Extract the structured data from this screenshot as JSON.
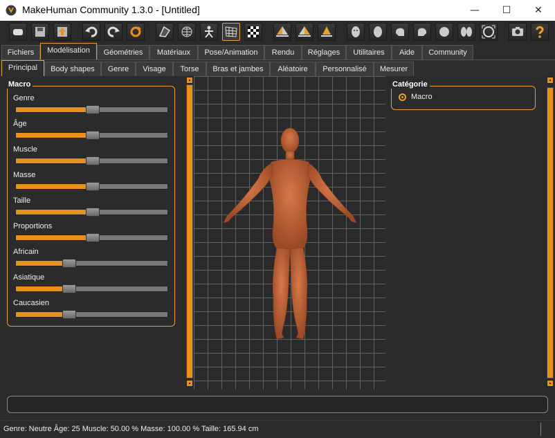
{
  "window": {
    "title": "MakeHuman Community 1.3.0 - [Untitled]",
    "controls": {
      "minimize": "—",
      "maximize": "☐",
      "close": "✕"
    }
  },
  "toolbar": {
    "icons": [
      "new-file-icon",
      "save-icon",
      "export-icon",
      "undo-icon",
      "redo-icon",
      "reset-icon",
      "smooth-icon",
      "wireframe-icon",
      "pose-icon",
      "grid-icon",
      "background-icon",
      "front-view-icon",
      "back-view-icon",
      "side-view-icon",
      "face-icon",
      "head-icon",
      "left-profile-icon",
      "right-profile-icon",
      "top-view-icon",
      "split-view-icon",
      "frame-icon",
      "screenshot-icon",
      "help-icon"
    ],
    "active_icon": "grid-icon",
    "accent_color": "#e8a030"
  },
  "main_tabs": [
    "Fichiers",
    "Modélisation",
    "Géométries",
    "Matériaux",
    "Pose/Animation",
    "Rendu",
    "Réglages",
    "Utilitaires",
    "Aide",
    "Community"
  ],
  "main_tab_active": "Modélisation",
  "sub_tabs": [
    "Principal",
    "Body shapes",
    "Genre",
    "Visage",
    "Torse",
    "Bras et jambes",
    "Aléatoire",
    "Personnalisé",
    "Mesurer"
  ],
  "sub_tab_active": "Principal",
  "macro": {
    "title": "Macro",
    "sliders": [
      {
        "label": "Genre",
        "value": 0.5
      },
      {
        "label": "Âge",
        "value": 0.5
      },
      {
        "label": "Muscle",
        "value": 0.5
      },
      {
        "label": "Masse",
        "value": 0.5
      },
      {
        "label": "Taille",
        "value": 0.5
      },
      {
        "label": "Proportions",
        "value": 0.5
      },
      {
        "label": "Africain",
        "value": 0.333
      },
      {
        "label": "Asiatique",
        "value": 0.333
      },
      {
        "label": "Caucasien",
        "value": 0.333
      }
    ]
  },
  "category": {
    "title": "Catégorie",
    "options": [
      "Macro"
    ],
    "selected": "Macro"
  },
  "status": "Genre: Neutre  Âge: 25  Muscle: 50.00 %  Masse: 100.00 %  Taille: 165.94 cm"
}
